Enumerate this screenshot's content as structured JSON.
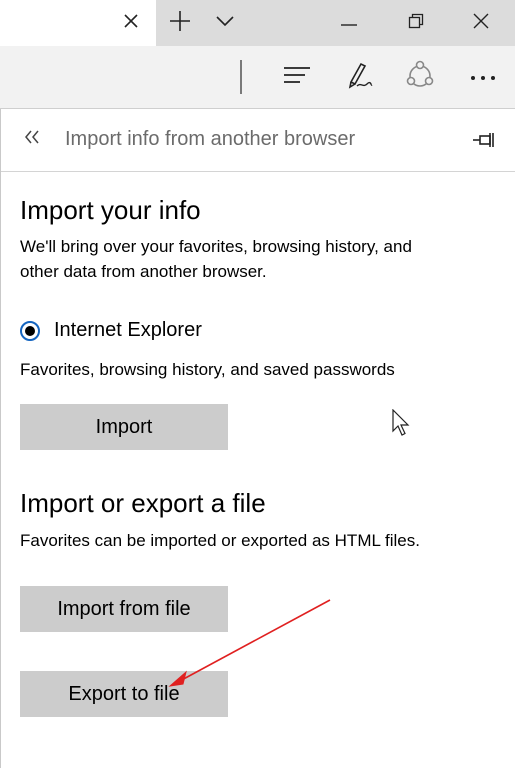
{
  "window": {
    "new_tab_symbol": "+",
    "close_tab_symbol": "✕"
  },
  "panel": {
    "title": "Import info from another browser"
  },
  "import_info": {
    "heading": "Import your info",
    "description_line1": "We'll bring over your favorites, browsing history, and",
    "description_line2": "other data from another browser.",
    "browser_option": "Internet Explorer",
    "browser_option_detail": "Favorites, browsing history, and saved passwords",
    "import_button": "Import"
  },
  "file_section": {
    "heading": "Import or export a file",
    "description": "Favorites can be imported or exported as HTML files.",
    "import_from_file_button": "Import from file",
    "export_to_file_button": "Export to file"
  },
  "icons": {
    "tab_close": "close-icon",
    "new_tab": "plus-icon",
    "tab_list": "chevron-down-icon",
    "minimize": "minimize-icon",
    "restore": "restore-icon",
    "window_close": "close-icon",
    "hub": "hub-icon",
    "web_note": "pen-icon",
    "share": "share-icon",
    "more": "more-icon",
    "back": "double-chevron-left-icon",
    "pin": "pin-icon"
  },
  "colors": {
    "accent": "#1565c0",
    "button_bg": "#cccccc",
    "annotation_arrow": "#e02020"
  }
}
